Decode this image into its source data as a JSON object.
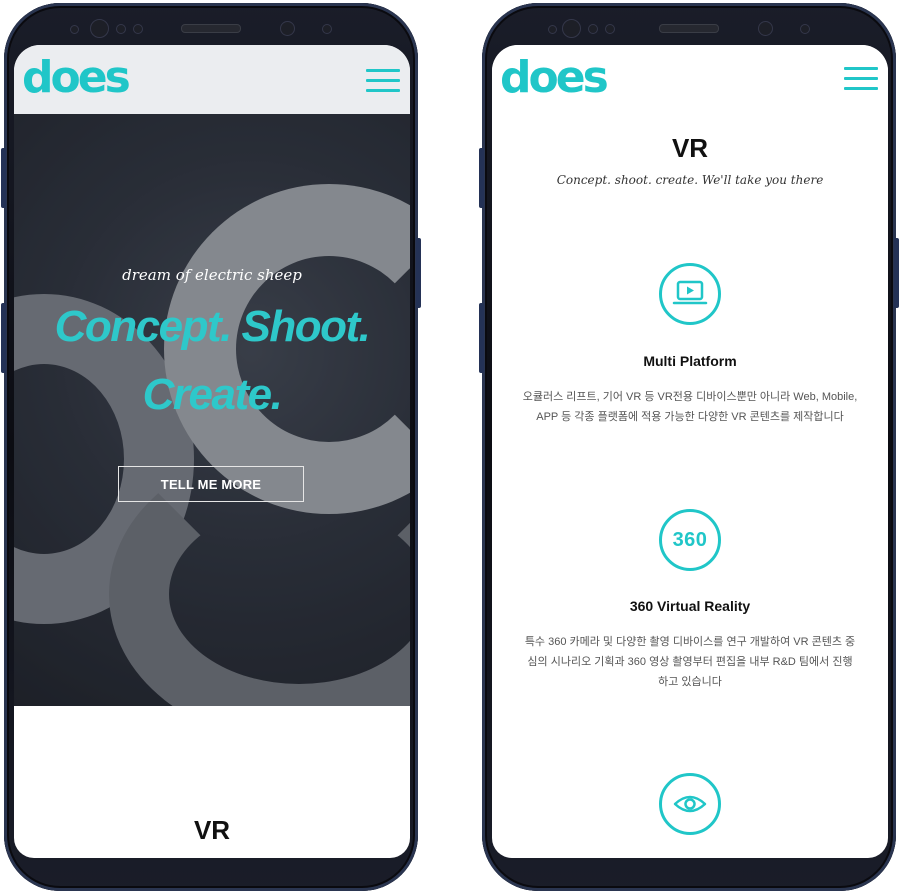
{
  "left_screen": {
    "header": {
      "logo": "does"
    },
    "hero": {
      "tagline": "dream of electric sheep",
      "title_line1": "Concept. Shoot.",
      "title_line2": "Create.",
      "cta_label": "TELL ME MORE"
    },
    "next_section_title": "VR"
  },
  "right_screen": {
    "header": {
      "logo": "does"
    },
    "section": {
      "title": "VR",
      "subtitle": "Concept. shoot. create. We'll take you there"
    },
    "features": [
      {
        "icon": "laptop-play-icon",
        "title": "Multi Platform",
        "desc_line1": "오큘러스 리프트, 기어 VR 등 VR전용 디바이스뿐만 아니라 Web, Mobile,",
        "desc_line2": "APP 등 각종 플랫폼에 적용 가능한 다양한 VR 콘텐츠를 제작합니다"
      },
      {
        "icon": "360-icon",
        "icon_text": "360",
        "title": "360 Virtual Reality",
        "desc_line1": "특수 360 카메라 및 다양한 촬영 디바이스를 연구 개발하여 VR 콘텐츠 중",
        "desc_line2": "심의 시나리오 기획과 360 영상 촬영부터 편집을 내부 R&D 팀에서 진행",
        "desc_line3": "하고 있습니다"
      },
      {
        "icon": "eye-icon"
      }
    ]
  },
  "colors": {
    "accent": "#20c6c8",
    "phone_body": "#0b0c12",
    "text_dark": "#111111"
  }
}
